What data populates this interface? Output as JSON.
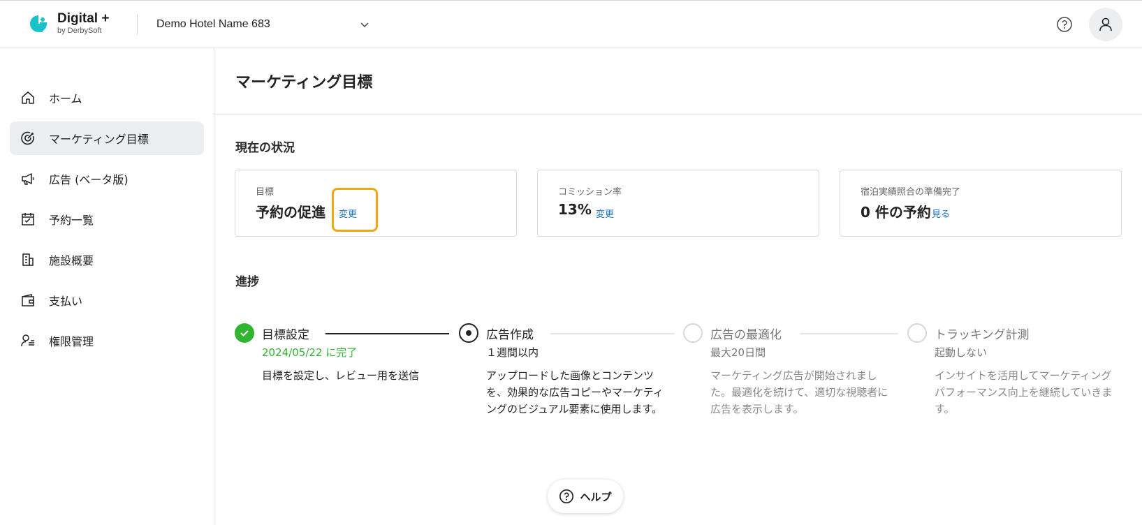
{
  "header": {
    "brand_title": "Digital +",
    "brand_sub": "by DerbySoft",
    "hotel_name": "Demo Hotel Name 683",
    "icons": {
      "logo": "derbysoft-logo",
      "dropdown": "chevron-down-icon",
      "help": "help-circle-icon",
      "account": "user-icon"
    }
  },
  "sidebar": {
    "items": [
      {
        "label": "ホーム",
        "icon": "home-icon",
        "active": false
      },
      {
        "label": "マーケティング目標",
        "icon": "target-icon",
        "active": true
      },
      {
        "label": "広告 (ベータ版)",
        "icon": "megaphone-icon",
        "active": false
      },
      {
        "label": "予約一覧",
        "icon": "calendar-check-icon",
        "active": false
      },
      {
        "label": "施設概要",
        "icon": "building-icon",
        "active": false
      },
      {
        "label": "支払い",
        "icon": "wallet-icon",
        "active": false
      },
      {
        "label": "権限管理",
        "icon": "user-list-icon",
        "active": false
      }
    ]
  },
  "main": {
    "title": "マーケティング目標",
    "status_section": "現在の状況",
    "cards": [
      {
        "label": "目標",
        "value": "予約の促進",
        "link": "変更"
      },
      {
        "label": "コミッション率",
        "value": "13%",
        "link": "変更"
      },
      {
        "label": "宿泊実績照合の準備完了",
        "value": "0 件の予約",
        "link": "見る"
      }
    ],
    "progress_section": "進捗",
    "steps": [
      {
        "title": "目標設定",
        "sub": "2024/05/22 に完了",
        "desc": "目標を設定し、レビュー用を送信",
        "state": "done"
      },
      {
        "title": "広告作成",
        "sub": "１週間以内",
        "desc": "アップロードした画像とコンテンツを、効果的な広告コピーやマーケティングのビジュアル要素に使用します。",
        "state": "current"
      },
      {
        "title": "広告の最適化",
        "sub": "最大20日間",
        "desc": "マーケティング広告が開始されました。最適化を続けて、適切な視聴者に広告を表示します。",
        "state": "pending"
      },
      {
        "title": "トラッキング計測",
        "sub": "起動しない",
        "desc": "インサイトを活用してマーケティング パフォーマンス向上を継続していきます。",
        "state": "pending"
      }
    ],
    "help_label": "ヘルプ"
  },
  "colors": {
    "accent": "#1a73c8",
    "success": "#2fb52f",
    "highlight": "#f2a614",
    "logo": "#17c3c9"
  }
}
